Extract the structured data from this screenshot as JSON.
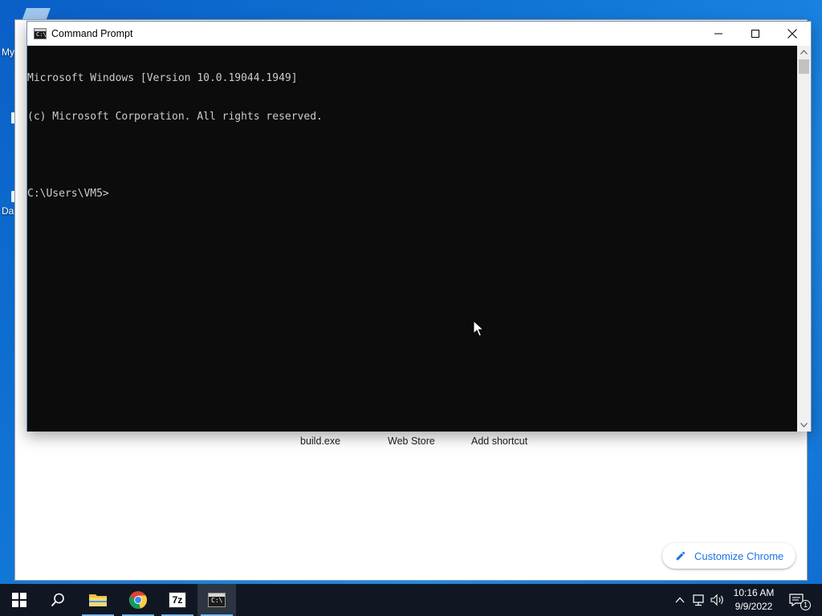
{
  "desktop": {
    "frag_labels": [
      "My",
      "Da"
    ]
  },
  "chrome": {
    "shortcuts": [
      {
        "label": "build.exe"
      },
      {
        "label": "Web Store"
      },
      {
        "label": "Add shortcut"
      }
    ],
    "customize_label": "Customize Chrome",
    "accent": "#1a73e8"
  },
  "cmd": {
    "title": "Command Prompt",
    "icon_glyph": "C:\\",
    "lines": [
      "Microsoft Windows [Version 10.0.19044.1949]",
      "(c) Microsoft Corporation. All rights reserved.",
      "",
      "C:\\Users\\VM5>"
    ],
    "bg_color": "#0c0c0c",
    "fg_color": "#cccccc"
  },
  "taskbar": {
    "items": [
      {
        "name": "start-button",
        "icon": "windows-logo-icon"
      },
      {
        "name": "search-button",
        "icon": "search-icon"
      },
      {
        "name": "file-explorer",
        "icon": "folder-icon"
      },
      {
        "name": "chrome",
        "icon": "chrome-icon"
      },
      {
        "name": "7zip",
        "icon": "7zip-icon",
        "label": "7z"
      },
      {
        "name": "command-prompt",
        "icon": "cmd-icon",
        "active": true
      }
    ],
    "clock": {
      "time": "10:16 AM",
      "date": "9/9/2022"
    },
    "notification_count": "1"
  }
}
